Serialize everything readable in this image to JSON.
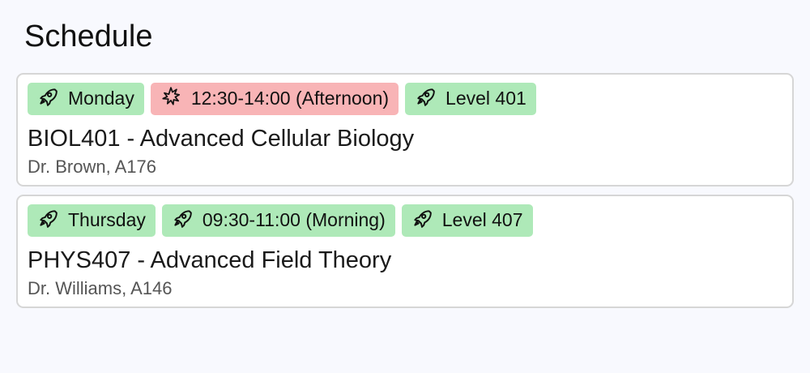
{
  "page": {
    "title": "Schedule"
  },
  "courses": [
    {
      "day": {
        "label": "Monday",
        "icon": "rocket-icon",
        "color": "#aee9b8"
      },
      "time": {
        "label": "12:30-14:00 (Afternoon)",
        "icon": "collision-icon",
        "color": "#f8b4b6"
      },
      "level": {
        "label": "Level 401",
        "icon": "rocket-icon",
        "color": "#aee9b8"
      },
      "title": "BIOL401 - Advanced Cellular Biology",
      "meta": "Dr. Brown, A176"
    },
    {
      "day": {
        "label": "Thursday",
        "icon": "rocket-icon",
        "color": "#aee9b8"
      },
      "time": {
        "label": "09:30-11:00 (Morning)",
        "icon": "rocket-icon",
        "color": "#aee9b8"
      },
      "level": {
        "label": "Level 407",
        "icon": "rocket-icon",
        "color": "#aee9b8"
      },
      "title": "PHYS407 - Advanced Field Theory",
      "meta": "Dr. Williams, A146"
    }
  ]
}
